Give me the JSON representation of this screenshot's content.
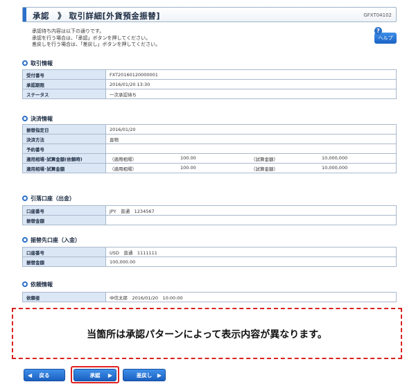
{
  "header": {
    "title": "承認　》 取引詳細[外貨預金振替]",
    "screen_id": "GFXT04102"
  },
  "intro": {
    "lines": [
      "承認待ち内容は以下の通りです。",
      "承認を行う場合は、「承認」ボタンを押してください。",
      "差戻しを行う場合は、「差戻し」ボタンを押してください。"
    ]
  },
  "help": {
    "label": "ヘルプ",
    "icon": "?"
  },
  "sections": {
    "transaction": {
      "title": "取引情報",
      "rows": [
        {
          "label": "受付番号",
          "value": "FXT20160120000001"
        },
        {
          "label": "承認期限",
          "value": "2016/01/20 13:30"
        },
        {
          "label": "ステータス",
          "value": "一次承認待ち"
        }
      ]
    },
    "settlement": {
      "title": "決済情報",
      "rows": [
        {
          "label": "振替指定日",
          "value": "2016/01/20"
        },
        {
          "label": "決済方法",
          "value": "直物"
        },
        {
          "label": "予約番号",
          "value": ""
        }
      ],
      "rate_rows": [
        {
          "label": "適用相場･試算金額(依頼時)",
          "rate_label": "（適用相場）",
          "rate": "100.00",
          "amount_label": "（試算金額）",
          "amount": "10,000,000"
        },
        {
          "label": "適用相場･試算金額",
          "rate_label": "（適用相場）",
          "rate": "100.00",
          "amount_label": "（試算金額）",
          "amount": "10,000,000"
        }
      ]
    },
    "debit": {
      "title": "引落口座（出金）",
      "rows": [
        {
          "label": "口座番号",
          "value": "JPY　普通　1234567"
        },
        {
          "label": "振替金額",
          "value": ""
        }
      ]
    },
    "credit": {
      "title": "振替先口座（入金）",
      "rows": [
        {
          "label": "口座番号",
          "value": "USD　普通　1111111"
        },
        {
          "label": "振替金額",
          "value": "100,000.00"
        }
      ]
    },
    "requester": {
      "title": "依頼情報",
      "rows": [
        {
          "label": "依頼者",
          "value": "中信太郎　2016/01/20　10:00:00"
        }
      ]
    }
  },
  "notice": "当箇所は承認パターンによって表示内容が異なります。",
  "buttons": {
    "back": "戻る",
    "approve": "承認",
    "reject": "差戻し"
  },
  "colors": {
    "accent": "#2a6fc9",
    "highlight": "#e02020",
    "label_bg": "#dbe7f5"
  }
}
